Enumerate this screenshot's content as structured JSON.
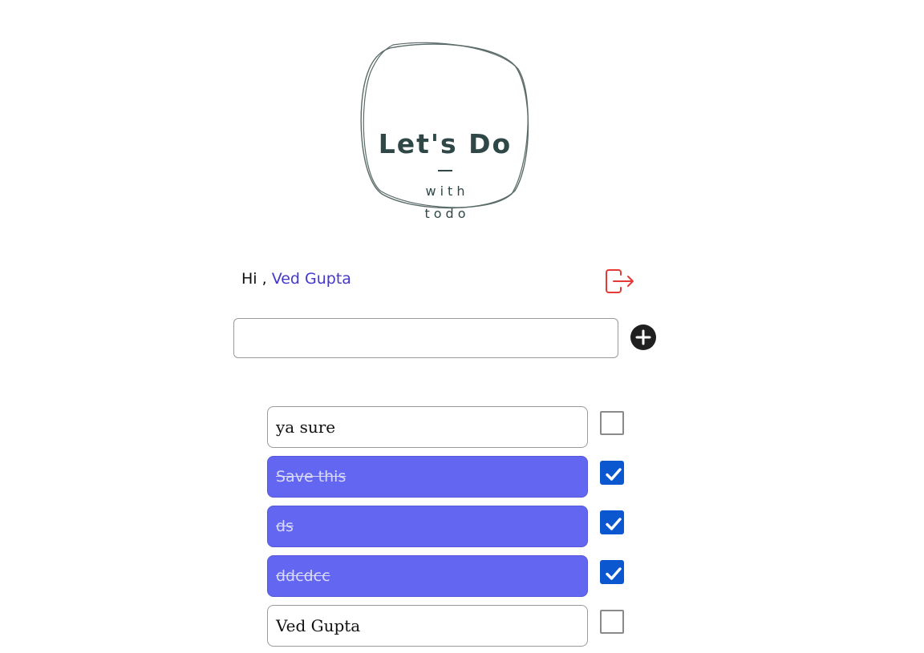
{
  "logo": {
    "title": "Let's Do",
    "with": "with",
    "todo": "todo"
  },
  "header": {
    "greeting": "Hi ,",
    "user_name": "Ved Gupta",
    "logout_icon": "logout-icon"
  },
  "new_todo": {
    "value": "",
    "placeholder": "",
    "add_icon": "plus-circle-icon"
  },
  "todos": [
    {
      "text": "ya sure",
      "done": false
    },
    {
      "text": "Save this",
      "done": true
    },
    {
      "text": "ds",
      "done": true
    },
    {
      "text": "ddcdcc",
      "done": true
    },
    {
      "text": "Ved Gupta",
      "done": false
    }
  ],
  "colors": {
    "accent": "#6366f1",
    "checkbox": "#0b57d0",
    "logout": "#e53935",
    "user_name": "#4338ca",
    "logo": "#2f4746"
  }
}
